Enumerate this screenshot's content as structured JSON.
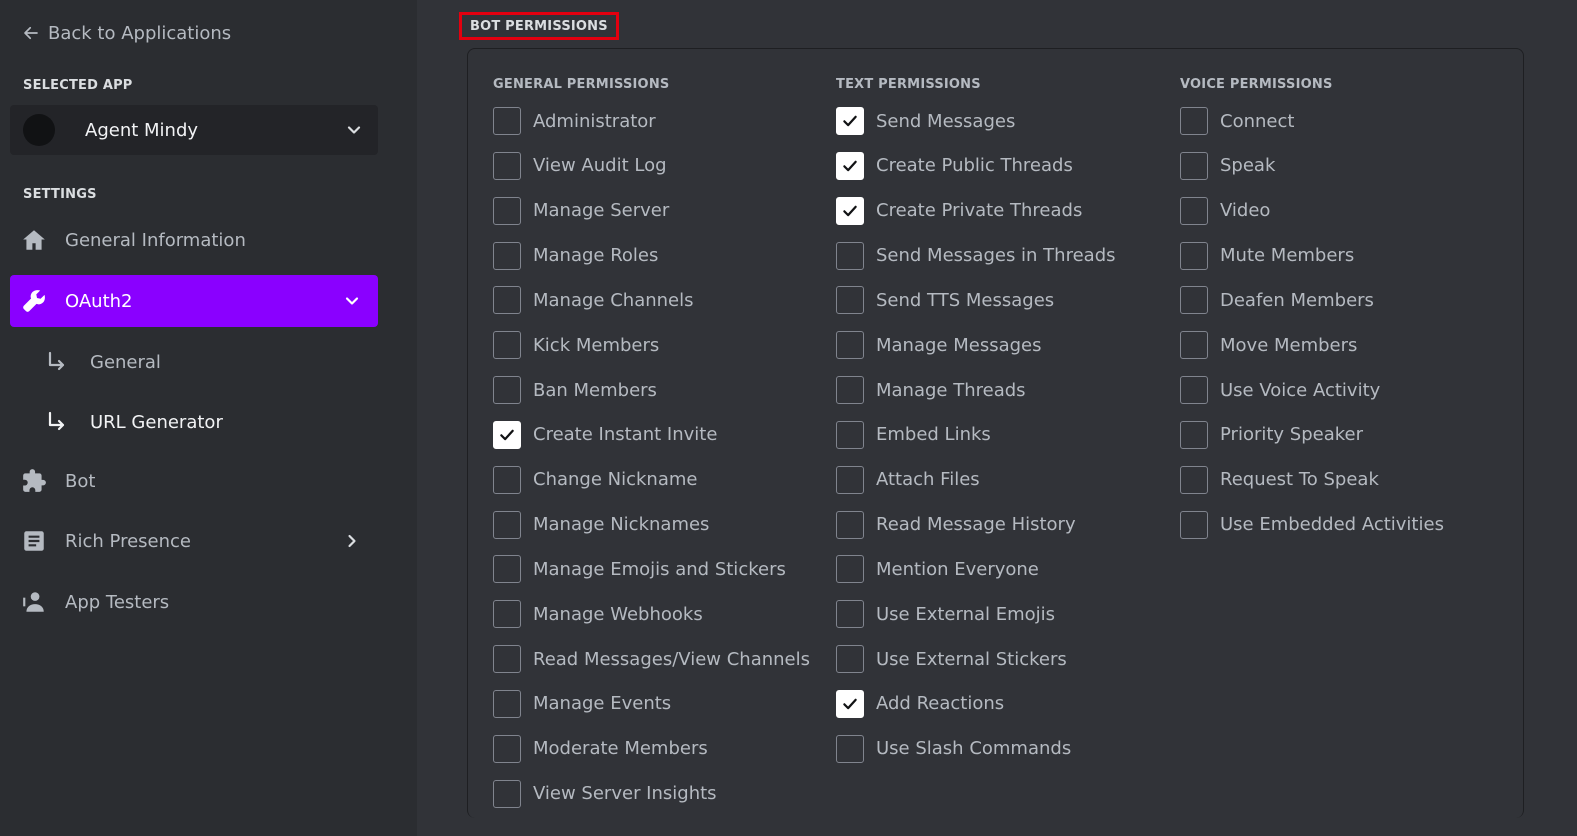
{
  "sidebar": {
    "back_label": "Back to Applications",
    "selected_app_label": "SELECTED APP",
    "app_name": "Agent Mindy",
    "settings_label": "SETTINGS",
    "items": [
      {
        "label": "General Information",
        "icon": "home-icon"
      },
      {
        "label": "OAuth2",
        "icon": "wrench-icon",
        "active": true
      },
      {
        "label": "Bot",
        "icon": "puzzle-icon"
      },
      {
        "label": "Rich Presence",
        "icon": "document-icon"
      },
      {
        "label": "App Testers",
        "icon": "person-icon"
      }
    ],
    "subitems": [
      {
        "label": "General"
      },
      {
        "label": "URL Generator"
      }
    ]
  },
  "main": {
    "section_title": "BOT PERMISSIONS",
    "columns": [
      {
        "heading": "GENERAL PERMISSIONS",
        "permissions": [
          {
            "label": "Administrator",
            "checked": false
          },
          {
            "label": "View Audit Log",
            "checked": false
          },
          {
            "label": "Manage Server",
            "checked": false
          },
          {
            "label": "Manage Roles",
            "checked": false
          },
          {
            "label": "Manage Channels",
            "checked": false
          },
          {
            "label": "Kick Members",
            "checked": false
          },
          {
            "label": "Ban Members",
            "checked": false
          },
          {
            "label": "Create Instant Invite",
            "checked": true
          },
          {
            "label": "Change Nickname",
            "checked": false
          },
          {
            "label": "Manage Nicknames",
            "checked": false
          },
          {
            "label": "Manage Emojis and Stickers",
            "checked": false
          },
          {
            "label": "Manage Webhooks",
            "checked": false
          },
          {
            "label": "Read Messages/View Channels",
            "checked": false
          },
          {
            "label": "Manage Events",
            "checked": false
          },
          {
            "label": "Moderate Members",
            "checked": false
          },
          {
            "label": "View Server Insights",
            "checked": false
          }
        ]
      },
      {
        "heading": "TEXT PERMISSIONS",
        "permissions": [
          {
            "label": "Send Messages",
            "checked": true
          },
          {
            "label": "Create Public Threads",
            "checked": true
          },
          {
            "label": "Create Private Threads",
            "checked": true
          },
          {
            "label": "Send Messages in Threads",
            "checked": false
          },
          {
            "label": "Send TTS Messages",
            "checked": false
          },
          {
            "label": "Manage Messages",
            "checked": false
          },
          {
            "label": "Manage Threads",
            "checked": false
          },
          {
            "label": "Embed Links",
            "checked": false
          },
          {
            "label": "Attach Files",
            "checked": false
          },
          {
            "label": "Read Message History",
            "checked": false
          },
          {
            "label": "Mention Everyone",
            "checked": false
          },
          {
            "label": "Use External Emojis",
            "checked": false
          },
          {
            "label": "Use External Stickers",
            "checked": false
          },
          {
            "label": "Add Reactions",
            "checked": true
          },
          {
            "label": "Use Slash Commands",
            "checked": false
          }
        ]
      },
      {
        "heading": "VOICE PERMISSIONS",
        "permissions": [
          {
            "label": "Connect",
            "checked": false
          },
          {
            "label": "Speak",
            "checked": false
          },
          {
            "label": "Video",
            "checked": false
          },
          {
            "label": "Mute Members",
            "checked": false
          },
          {
            "label": "Deafen Members",
            "checked": false
          },
          {
            "label": "Move Members",
            "checked": false
          },
          {
            "label": "Use Voice Activity",
            "checked": false
          },
          {
            "label": "Priority Speaker",
            "checked": false
          },
          {
            "label": "Request To Speak",
            "checked": false
          },
          {
            "label": "Use Embedded Activities",
            "checked": false
          }
        ]
      }
    ]
  },
  "colors": {
    "accent": "#8a00ff",
    "highlight_border": "#e3000f",
    "background": "#313338",
    "sidebar_background": "#2b2d31"
  }
}
